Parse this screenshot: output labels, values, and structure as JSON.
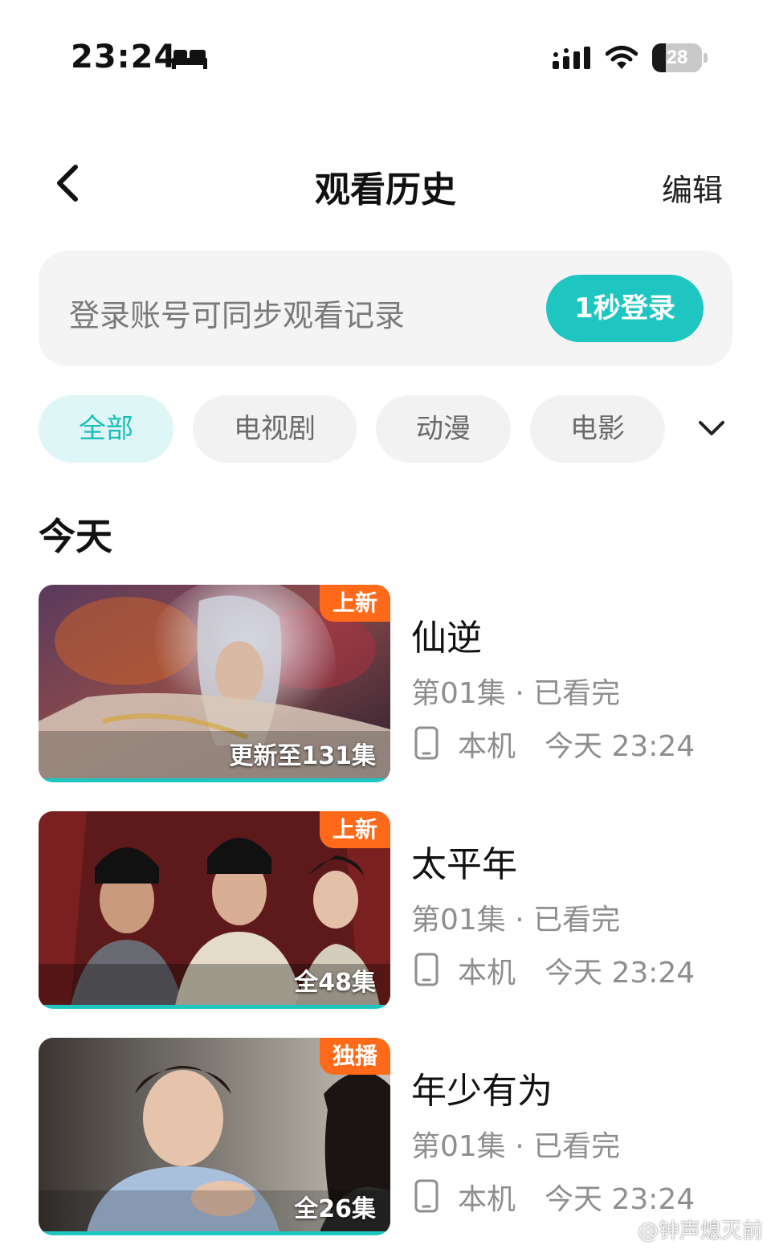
{
  "status_bar": {
    "time": "23:24",
    "battery_level": "28",
    "battery_fraction": 0.28
  },
  "header": {
    "title": "观看历史",
    "edit_label": "编辑"
  },
  "login_banner": {
    "prompt": "登录账号可同步观看记录",
    "button_label": "1秒登录"
  },
  "filters": [
    {
      "label": "全部",
      "active": true
    },
    {
      "label": "电视剧",
      "active": false
    },
    {
      "label": "动漫",
      "active": false
    },
    {
      "label": "电影",
      "active": false
    }
  ],
  "section": {
    "title": "今天"
  },
  "items": [
    {
      "title": "仙逆",
      "badge": "上新",
      "episode_info": "更新至131集",
      "progress_text": "第01集 · 已看完",
      "device": "本机",
      "time": "今天 23:24",
      "watched_fraction": 1.0
    },
    {
      "title": "太平年",
      "badge": "上新",
      "episode_info": "全48集",
      "progress_text": "第01集 · 已看完",
      "device": "本机",
      "time": "今天 23:24",
      "watched_fraction": 1.0
    },
    {
      "title": "年少有为",
      "badge": "独播",
      "episode_info": "全26集",
      "progress_text": "第01集 · 已看完",
      "device": "本机",
      "time": "今天 23:24",
      "watched_fraction": 1.0
    }
  ],
  "colors": {
    "accent": "#1ec5c1",
    "badge": "#ff6a1a"
  },
  "watermark": "@钟声熄灭前"
}
